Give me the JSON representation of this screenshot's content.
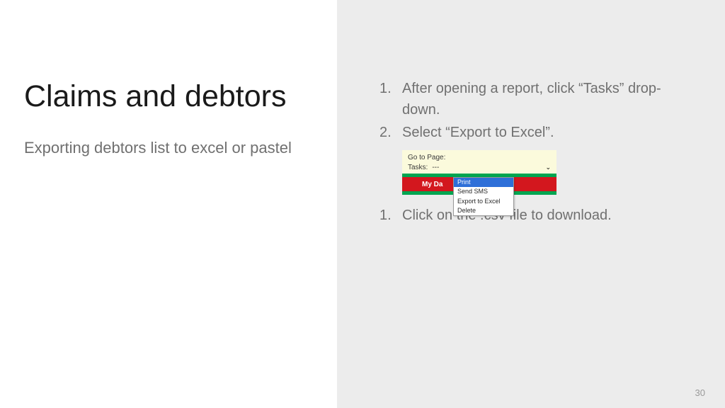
{
  "left": {
    "title": "Claims and debtors",
    "subtitle": "Exporting debtors list to excel or pastel"
  },
  "right": {
    "list1": {
      "item1": "After opening a report, click “Tasks” drop-down.",
      "item2": "Select “Export to Excel”."
    },
    "list2": {
      "item1": "Click on the .csv file to download."
    }
  },
  "embedded": {
    "goToPageLabel": "Go to Page:",
    "tasksLabel": "Tasks:",
    "selectedValue": "---",
    "myDashboard": "My Da",
    "dropdown": {
      "opt1": "Print",
      "opt2": "Send SMS",
      "opt3": "Export to Excel",
      "opt4": "Delete"
    }
  },
  "pageNumber": "30"
}
